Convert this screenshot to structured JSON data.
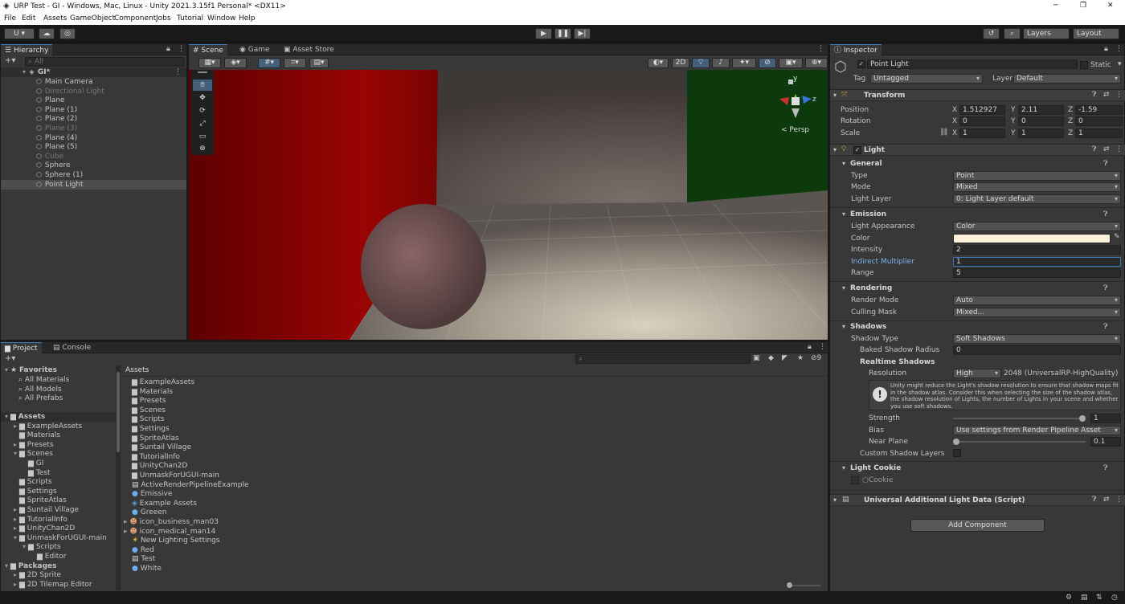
{
  "window": {
    "title": "URP Test - GI - Windows, Mac, Linux - Unity 2021.3.15f1 Personal* <DX11>",
    "minimize": "─",
    "maximize": "❐",
    "close": "✕"
  },
  "menu": [
    "File",
    "Edit",
    "Assets",
    "GameObject",
    "Component",
    "Jobs",
    "Tutorial",
    "Window",
    "Help"
  ],
  "toolbar": {
    "account": "U ▾",
    "layers": "Layers",
    "layout": "Layout"
  },
  "hierarchy": {
    "tab": "Hierarchy",
    "search_placeholder": "All",
    "scene": "GI*",
    "items": [
      {
        "name": "Main Camera",
        "dim": false
      },
      {
        "name": "Directional Light",
        "dim": true
      },
      {
        "name": "Plane",
        "dim": false
      },
      {
        "name": "Plane (1)",
        "dim": false
      },
      {
        "name": "Plane (2)",
        "dim": false
      },
      {
        "name": "Plane (3)",
        "dim": true
      },
      {
        "name": "Plane (4)",
        "dim": false
      },
      {
        "name": "Plane (5)",
        "dim": false
      },
      {
        "name": "Cube",
        "dim": true
      },
      {
        "name": "Sphere",
        "dim": false
      },
      {
        "name": "Sphere (1)",
        "dim": false
      },
      {
        "name": "Point Light",
        "dim": false,
        "selected": true
      }
    ]
  },
  "scene_tabs": {
    "scene": "Scene",
    "game": "Game",
    "store": "Asset Store"
  },
  "scene": {
    "two_d": "2D",
    "persp": "< Persp",
    "gizmo_y": "y",
    "gizmo_z": "z"
  },
  "project": {
    "tabs": {
      "project": "Project",
      "console": "Console"
    },
    "hidden_count": "9",
    "favorites": {
      "label": "Favorites",
      "items": [
        "All Materials",
        "All Models",
        "All Prefabs"
      ]
    },
    "tree": [
      "Assets",
      "ExampleAssets",
      "Materials",
      "Presets",
      "Scenes",
      "GI",
      "Test",
      "Scripts",
      "Settings",
      "SpriteAtlas",
      "Suntail Village",
      "TutorialInfo",
      "UnityChan2D",
      "UnmaskForUGUI-main",
      "Scripts",
      "Editor",
      "Packages",
      "2D Sprite",
      "2D Tilemap Editor"
    ],
    "breadcrumb": "Assets",
    "files": [
      {
        "name": "ExampleAssets",
        "icon": "folder"
      },
      {
        "name": "Materials",
        "icon": "folder"
      },
      {
        "name": "Presets",
        "icon": "folder"
      },
      {
        "name": "Scenes",
        "icon": "folder"
      },
      {
        "name": "Scripts",
        "icon": "folder"
      },
      {
        "name": "Settings",
        "icon": "folder"
      },
      {
        "name": "SpriteAtlas",
        "icon": "folder"
      },
      {
        "name": "Suntail Village",
        "icon": "folder"
      },
      {
        "name": "TutorialInfo",
        "icon": "folder"
      },
      {
        "name": "UnityChan2D",
        "icon": "folder"
      },
      {
        "name": "UnmaskForUGUI-main",
        "icon": "folder"
      },
      {
        "name": "ActiveRenderPipelineExample",
        "icon": "script"
      },
      {
        "name": "Emissive",
        "icon": "material"
      },
      {
        "name": "Example Assets",
        "icon": "prefab"
      },
      {
        "name": "Greeen",
        "icon": "material"
      },
      {
        "name": "icon_business_man03",
        "icon": "sprite"
      },
      {
        "name": "icon_medical_man14",
        "icon": "sprite"
      },
      {
        "name": "New Lighting Settings",
        "icon": "lighting"
      },
      {
        "name": "Red",
        "icon": "material"
      },
      {
        "name": "Test",
        "icon": "script"
      },
      {
        "name": "White",
        "icon": "material"
      }
    ]
  },
  "inspector": {
    "tab": "Inspector",
    "object_name": "Point Light",
    "static": "Static",
    "tag_label": "Tag",
    "tag": "Untagged",
    "layer_label": "Layer",
    "layer": "Default",
    "transform": {
      "title": "Transform",
      "position_label": "Position",
      "rotation_label": "Rotation",
      "scale_label": "Scale",
      "position": [
        "1.512927",
        "2.11",
        "-1.59"
      ],
      "rotation": [
        "0",
        "0",
        "0"
      ],
      "scale": [
        "1",
        "1",
        "1"
      ]
    },
    "light": {
      "title": "Light",
      "general": "General",
      "type_label": "Type",
      "type": "Point",
      "mode_label": "Mode",
      "mode": "Mixed",
      "layer_label": "Light Layer",
      "layer": "0: Light Layer default",
      "emission": "Emission",
      "appearance_label": "Light Appearance",
      "appearance": "Color",
      "color_label": "Color",
      "color": "#fdf1dc",
      "intensity_label": "Intensity",
      "intensity": "2",
      "indirect_label": "Indirect Multiplier",
      "indirect": "1",
      "range_label": "Range",
      "range": "5",
      "rendering": "Rendering",
      "render_mode_label": "Render Mode",
      "render_mode": "Auto",
      "culling_label": "Culling Mask",
      "culling": "Mixed...",
      "shadows": "Shadows",
      "shadow_type_label": "Shadow Type",
      "shadow_type": "Soft Shadows",
      "baked_radius_label": "Baked Shadow Radius",
      "baked_radius": "0",
      "realtime": "Realtime Shadows",
      "resolution_label": "Resolution",
      "resolution": "High",
      "resolution_value": "2048 (UniversalRP-HighQuality)",
      "warning": "Unity might reduce the Light's shadow resolution to ensure that shadow maps fit in the shadow atlas. Consider this when selecting the size of the shadow atlas, the shadow resolution of Lights, the number of Lights in your scene and whether you use soft shadows.",
      "strength_label": "Strength",
      "strength": "1",
      "strength_level": 1,
      "bias_label": "Bias",
      "bias": "Use settings from Render Pipeline Asset",
      "near_label": "Near Plane",
      "near": "0.1",
      "near_level": 0,
      "custom_layers_label": "Custom Shadow Layers",
      "cookie": "Light Cookie",
      "cookie_field": "Cookie"
    },
    "additional": "Universal Additional Light Data (Script)",
    "add_component": "Add Component"
  }
}
